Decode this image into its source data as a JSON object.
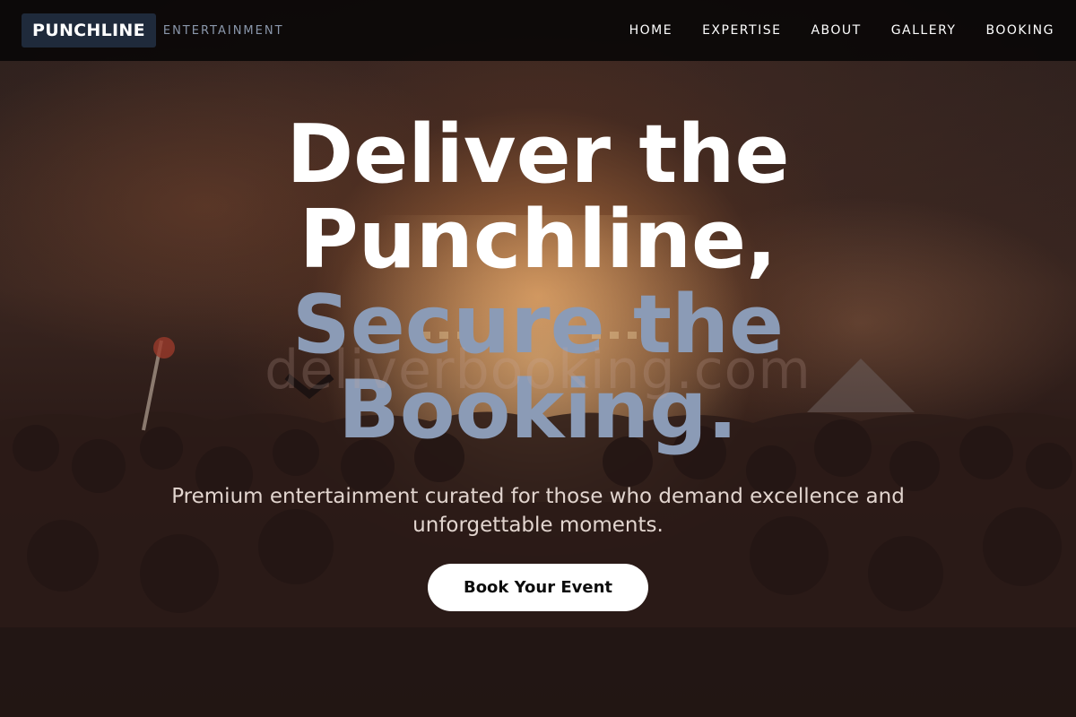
{
  "brand": {
    "name": "PUNCHLINE",
    "tagline": "ENTERTAINMENT"
  },
  "nav": {
    "items": [
      "HOME",
      "EXPERTISE",
      "ABOUT",
      "GALLERY",
      "BOOKING"
    ]
  },
  "hero": {
    "headline_line1": "Deliver the",
    "headline_line2": "Punchline,",
    "headline_line3": "Secure the",
    "headline_line4": "Booking.",
    "watermark": "deliverbooking.com",
    "subhead_line1": "Premium entertainment curated for those who demand excellence and",
    "subhead_line2": "unforgettable moments.",
    "cta_label": "Book Your Event"
  },
  "colors": {
    "accent": "#8b9bb6",
    "brand_box": "#1f2a3b",
    "navbar": "#0a0808"
  }
}
